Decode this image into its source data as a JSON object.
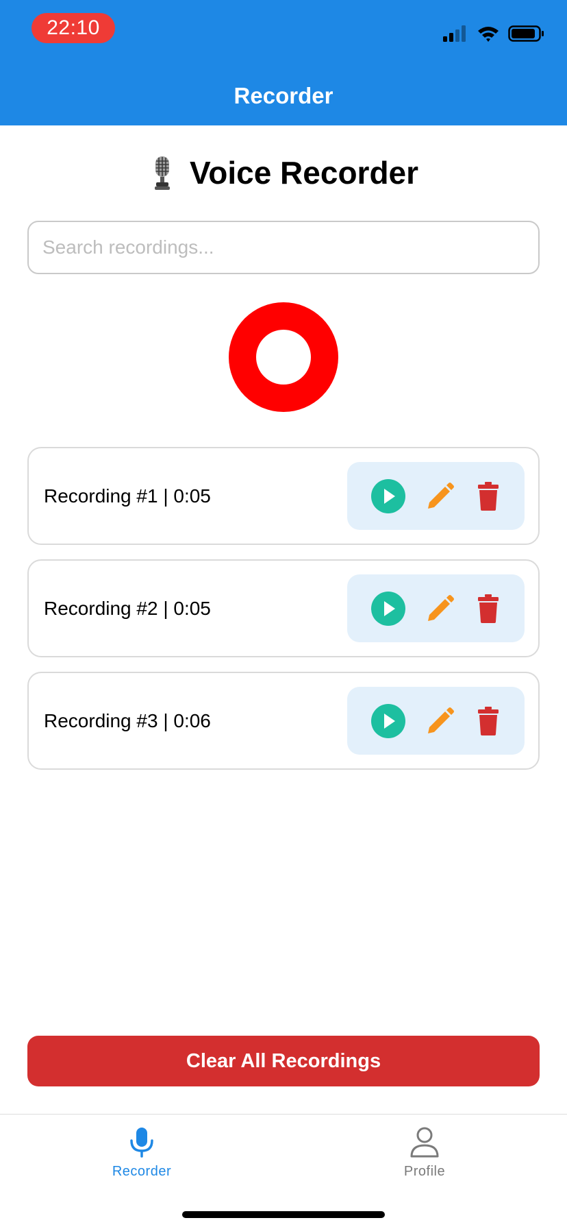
{
  "status_bar": {
    "time": "22:10",
    "icons": [
      "signal-icon",
      "wifi-icon",
      "battery-icon"
    ]
  },
  "header": {
    "title": "Recorder"
  },
  "main": {
    "heading_icon": "studio-microphone-emoji",
    "heading": "Voice Recorder",
    "search_placeholder": "Search recordings...",
    "search_value": "",
    "record_button_icon": "record-icon"
  },
  "recordings": [
    {
      "label": "Recording #1 | 0:05",
      "actions": [
        "play-icon",
        "pencil-icon",
        "trash-icon"
      ]
    },
    {
      "label": "Recording #2 | 0:05",
      "actions": [
        "play-icon",
        "pencil-icon",
        "trash-icon"
      ]
    },
    {
      "label": "Recording #3 | 0:06",
      "actions": [
        "play-icon",
        "pencil-icon",
        "trash-icon"
      ]
    }
  ],
  "clear_button": {
    "label": "Clear All Recordings"
  },
  "tab_bar": {
    "tabs": [
      {
        "label": "Recorder",
        "icon": "microphone-icon",
        "active": true
      },
      {
        "label": "Profile",
        "icon": "person-icon",
        "active": false
      }
    ]
  },
  "colors": {
    "primary": "#1E88E5",
    "record": "#FF0000",
    "danger": "#D32F2F",
    "play": "#1DBFA0",
    "edit": "#F7941D",
    "delete": "#D32F2F",
    "action_panel_bg": "#E3F0FB"
  }
}
